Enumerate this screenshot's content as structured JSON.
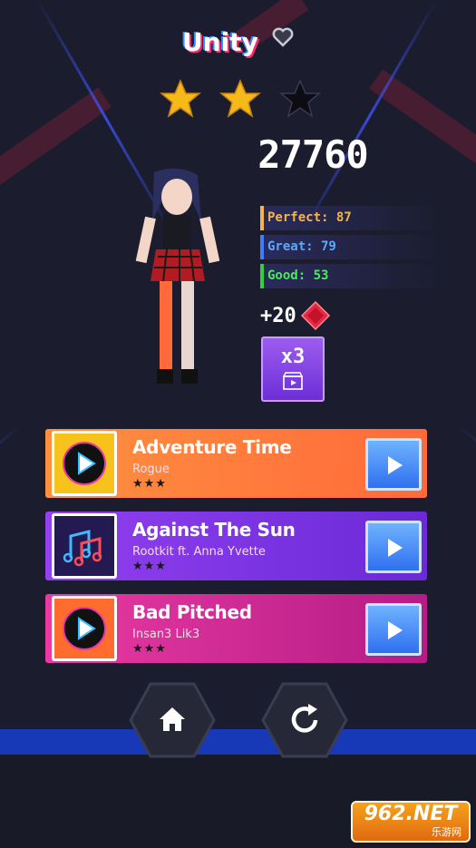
{
  "level": {
    "title": "Unity",
    "stars_earned": 2,
    "stars_total": 3
  },
  "result": {
    "score": "27760",
    "perfect": "Perfect: 87",
    "great": "Great: 79",
    "good": "Good: 53",
    "reward": "+20",
    "multiplier": "x3"
  },
  "songs": [
    {
      "title": "Adventure Time",
      "artist": "Rogue",
      "rating": "★★★"
    },
    {
      "title": "Against The Sun",
      "artist": "Rootkit ft. Anna Yvette",
      "rating": "★★★"
    },
    {
      "title": "Bad Pitched",
      "artist": "Insan3 Lik3",
      "rating": "★★★"
    }
  ],
  "watermark": {
    "brand": "962.NET",
    "sub": "乐游网"
  },
  "colors": {
    "star": "#f7b81a",
    "accent_orange": "#ff7a3d",
    "accent_purple": "#7b36e0",
    "accent_pink": "#d1309a",
    "floor": "#1739b8"
  }
}
